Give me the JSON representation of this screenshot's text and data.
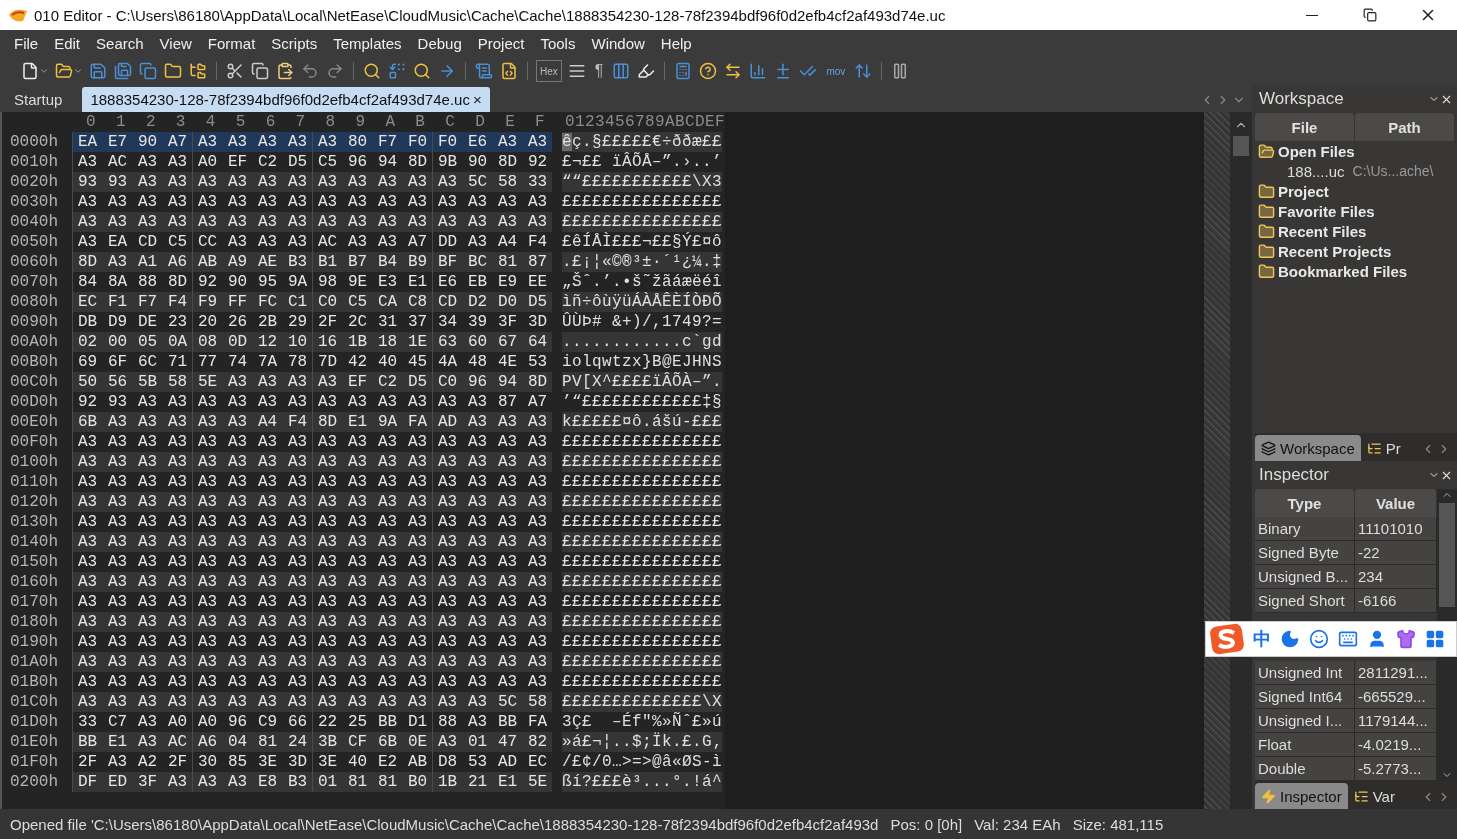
{
  "window": {
    "title": "010 Editor - C:\\Users\\86180\\AppData\\Local\\NetEase\\CloudMusic\\Cache\\Cache\\1888354230-128-78f2394bdf96f0d2efb4cf2af493d74e.uc"
  },
  "menu": [
    "File",
    "Edit",
    "Search",
    "View",
    "Format",
    "Scripts",
    "Templates",
    "Debug",
    "Project",
    "Tools",
    "Window",
    "Help"
  ],
  "toolbar": {
    "hex_label": "Hex",
    "pilcrow": "¶",
    "mov_label": "mov"
  },
  "tabs": [
    {
      "label": "Startup",
      "selected": false
    },
    {
      "label": "1888354230-128-78f2394bdf96f0d2efb4cf2af493d74e.uc",
      "selected": true,
      "close": "×"
    }
  ],
  "hex_view": {
    "columns": [
      "0",
      "1",
      "2",
      "3",
      "4",
      "5",
      "6",
      "7",
      "8",
      "9",
      "A",
      "B",
      "C",
      "D",
      "E",
      "F"
    ],
    "ascii_header": "0123456789ABCDEF",
    "rows": [
      {
        "offset": "0000h",
        "bytes": [
          "EA E7 90 A7",
          "A3 A3 A3 A3",
          "A3 80 F7 F0",
          "F0 E6 A3 A3"
        ],
        "ascii": "êç.§£££££€÷ððæ££",
        "selected": true
      },
      {
        "offset": "0010h",
        "bytes": [
          "A3 AC A3 A3",
          "A0 EF C2 D5",
          "C5 96 94 8D",
          "9B 90 8D 92"
        ],
        "ascii": "£¬££ ïÂÕÅ–”.›..’",
        "selected": false
      },
      {
        "offset": "0020h",
        "bytes": [
          "93 93 A3 A3",
          "A3 A3 A3 A3",
          "A3 A3 A3 A3",
          "A3 5C 58 33"
        ],
        "ascii": "““£££££££££££\\X3",
        "selected": false
      },
      {
        "offset": "0030h",
        "bytes": [
          "A3 A3 A3 A3",
          "A3 A3 A3 A3",
          "A3 A3 A3 A3",
          "A3 A3 A3 A3"
        ],
        "ascii": "££££££££££££££££",
        "selected": false
      },
      {
        "offset": "0040h",
        "bytes": [
          "A3 A3 A3 A3",
          "A3 A3 A3 A3",
          "A3 A3 A3 A3",
          "A3 A3 A3 A3"
        ],
        "ascii": "££££££££££££££££",
        "selected": false
      },
      {
        "offset": "0050h",
        "bytes": [
          "A3 EA CD C5",
          "CC A3 A3 A3",
          "AC A3 A3 A7",
          "DD A3 A4 F4"
        ],
        "ascii": "£êÍÅÌ£££¬££§Ý£¤ô",
        "selected": false
      },
      {
        "offset": "0060h",
        "bytes": [
          "8D A3 A1 A6",
          "AB A9 AE B3",
          "B1 B7 B4 B9",
          "BF BC 81 87"
        ],
        "ascii": ".£¡¦«©®³±·´¹¿¼.‡",
        "selected": false
      },
      {
        "offset": "0070h",
        "bytes": [
          "84 8A 88 8D",
          "92 90 95 9A",
          "98 9E E3 E1",
          "E6 EB E9 EE"
        ],
        "ascii": "„Šˆ.’.•š˜žãáæëéî",
        "selected": false
      },
      {
        "offset": "0080h",
        "bytes": [
          "EC F1 F7 F4",
          "F9 FF FC C1",
          "C0 C5 CA C8",
          "CD D2 D0 D5"
        ],
        "ascii": "ìñ÷ôùÿüÁÀÅÊÈÍÒÐÕ",
        "selected": false
      },
      {
        "offset": "0090h",
        "bytes": [
          "DB D9 DE 23",
          "20 26 2B 29",
          "2F 2C 31 37",
          "34 39 3F 3D"
        ],
        "ascii": "ÛÙÞ# &+)/,1749?=",
        "selected": false
      },
      {
        "offset": "00A0h",
        "bytes": [
          "02 00 05 0A",
          "08 0D 12 10",
          "16 1B 18 1E",
          "63 60 67 64"
        ],
        "ascii": "............c`gd",
        "selected": false
      },
      {
        "offset": "00B0h",
        "bytes": [
          "69 6F 6C 71",
          "77 74 7A 78",
          "7D 42 40 45",
          "4A 48 4E 53"
        ],
        "ascii": "iolqwtzx}B@EJHNS",
        "selected": false
      },
      {
        "offset": "00C0h",
        "bytes": [
          "50 56 5B 58",
          "5E A3 A3 A3",
          "A3 EF C2 D5",
          "C0 96 94 8D"
        ],
        "ascii": "PV[X^££££ïÂÕÀ–”.",
        "selected": false
      },
      {
        "offset": "00D0h",
        "bytes": [
          "92 93 A3 A3",
          "A3 A3 A3 A3",
          "A3 A3 A3 A3",
          "A3 A3 87 A7"
        ],
        "ascii": "’“££££££££££££‡§",
        "selected": false
      },
      {
        "offset": "00E0h",
        "bytes": [
          "6B A3 A3 A3",
          "A3 A3 A4 F4",
          "8D E1 9A FA",
          "AD A3 A3 A3"
        ],
        "ascii": "k£££££¤ô.ášú-£££",
        "selected": false
      },
      {
        "offset": "00F0h",
        "bytes": [
          "A3 A3 A3 A3",
          "A3 A3 A3 A3",
          "A3 A3 A3 A3",
          "A3 A3 A3 A3"
        ],
        "ascii": "££££££££££££££££",
        "selected": false
      },
      {
        "offset": "0100h",
        "bytes": [
          "A3 A3 A3 A3",
          "A3 A3 A3 A3",
          "A3 A3 A3 A3",
          "A3 A3 A3 A3"
        ],
        "ascii": "££££££££££££££££",
        "selected": false
      },
      {
        "offset": "0110h",
        "bytes": [
          "A3 A3 A3 A3",
          "A3 A3 A3 A3",
          "A3 A3 A3 A3",
          "A3 A3 A3 A3"
        ],
        "ascii": "££££££££££££££££",
        "selected": false
      },
      {
        "offset": "0120h",
        "bytes": [
          "A3 A3 A3 A3",
          "A3 A3 A3 A3",
          "A3 A3 A3 A3",
          "A3 A3 A3 A3"
        ],
        "ascii": "££££££££££££££££",
        "selected": false
      },
      {
        "offset": "0130h",
        "bytes": [
          "A3 A3 A3 A3",
          "A3 A3 A3 A3",
          "A3 A3 A3 A3",
          "A3 A3 A3 A3"
        ],
        "ascii": "££££££££££££££££",
        "selected": false
      },
      {
        "offset": "0140h",
        "bytes": [
          "A3 A3 A3 A3",
          "A3 A3 A3 A3",
          "A3 A3 A3 A3",
          "A3 A3 A3 A3"
        ],
        "ascii": "££££££££££££££££",
        "selected": false
      },
      {
        "offset": "0150h",
        "bytes": [
          "A3 A3 A3 A3",
          "A3 A3 A3 A3",
          "A3 A3 A3 A3",
          "A3 A3 A3 A3"
        ],
        "ascii": "££££££££££££££££",
        "selected": false
      },
      {
        "offset": "0160h",
        "bytes": [
          "A3 A3 A3 A3",
          "A3 A3 A3 A3",
          "A3 A3 A3 A3",
          "A3 A3 A3 A3"
        ],
        "ascii": "££££££££££££££££",
        "selected": false
      },
      {
        "offset": "0170h",
        "bytes": [
          "A3 A3 A3 A3",
          "A3 A3 A3 A3",
          "A3 A3 A3 A3",
          "A3 A3 A3 A3"
        ],
        "ascii": "££££££££££££££££",
        "selected": false
      },
      {
        "offset": "0180h",
        "bytes": [
          "A3 A3 A3 A3",
          "A3 A3 A3 A3",
          "A3 A3 A3 A3",
          "A3 A3 A3 A3"
        ],
        "ascii": "££££££££££££££££",
        "selected": false
      },
      {
        "offset": "0190h",
        "bytes": [
          "A3 A3 A3 A3",
          "A3 A3 A3 A3",
          "A3 A3 A3 A3",
          "A3 A3 A3 A3"
        ],
        "ascii": "££££££££££££££££",
        "selected": false
      },
      {
        "offset": "01A0h",
        "bytes": [
          "A3 A3 A3 A3",
          "A3 A3 A3 A3",
          "A3 A3 A3 A3",
          "A3 A3 A3 A3"
        ],
        "ascii": "££££££££££££££££",
        "selected": false
      },
      {
        "offset": "01B0h",
        "bytes": [
          "A3 A3 A3 A3",
          "A3 A3 A3 A3",
          "A3 A3 A3 A3",
          "A3 A3 A3 A3"
        ],
        "ascii": "££££££££££££££££",
        "selected": false
      },
      {
        "offset": "01C0h",
        "bytes": [
          "A3 A3 A3 A3",
          "A3 A3 A3 A3",
          "A3 A3 A3 A3",
          "A3 A3 5C 58"
        ],
        "ascii": "££££££££££££££\\X",
        "selected": false
      },
      {
        "offset": "01D0h",
        "bytes": [
          "33 C7 A3 A0",
          "A0 96 C9 66",
          "22 25 BB D1",
          "88 A3 BB FA"
        ],
        "ascii": "3Ç£  –Éf\"%»Ñˆ£»ú",
        "selected": false
      },
      {
        "offset": "01E0h",
        "bytes": [
          "BB E1 A3 AC",
          "A6 04 81 24",
          "3B CF 6B 0E",
          "A3 01 47 82"
        ],
        "ascii": "»á£¬¦..$;Ïk.£.G‚",
        "selected": false
      },
      {
        "offset": "01F0h",
        "bytes": [
          "2F A3 A2 2F",
          "30 85 3E 3D",
          "3E 40 E2 AB",
          "D8 53 AD EC"
        ],
        "ascii": "/£¢/0…>=>@â«ØS-ì",
        "selected": false
      },
      {
        "offset": "0200h",
        "bytes": [
          "DF ED 3F A3",
          "A3 A3 E8 B3",
          "01 81 81 B0",
          "1B 21 E1 5E"
        ],
        "ascii": "ßí?£££è³...°.!á^",
        "selected": false
      }
    ]
  },
  "workspace": {
    "title": "Workspace",
    "columns": [
      "File",
      "Path"
    ],
    "tree": [
      {
        "label": "Open Files",
        "children": [
          {
            "label": "188....uc",
            "path": "C:\\Us...ache\\"
          }
        ]
      },
      {
        "label": "Project"
      },
      {
        "label": "Favorite Files"
      },
      {
        "label": "Recent Files"
      },
      {
        "label": "Recent Projects"
      },
      {
        "label": "Bookmarked Files"
      }
    ],
    "tabs": [
      {
        "label": "Workspace",
        "selected": true
      },
      {
        "label": "Pr",
        "selected": false
      }
    ]
  },
  "inspector": {
    "title": "Inspector",
    "columns": [
      "Type",
      "Value"
    ],
    "rows": [
      {
        "type": "Binary",
        "value": "11101010"
      },
      {
        "type": "Signed Byte",
        "value": "-22"
      },
      {
        "type": "Unsigned B...",
        "value": "234"
      },
      {
        "type": "Signed Short",
        "value": "-6166"
      },
      {
        "type": "Unsigned Int",
        "value": "2811291..."
      },
      {
        "type": "Signed Int64",
        "value": "-665529..."
      },
      {
        "type": "Unsigned I...",
        "value": "1179144..."
      },
      {
        "type": "Float",
        "value": "-4.0219..."
      },
      {
        "type": "Double",
        "value": "-5.2773..."
      }
    ],
    "tabs": [
      {
        "label": "Inspector",
        "selected": true
      },
      {
        "label": "Var",
        "selected": false
      }
    ]
  },
  "ime_toolbar": {
    "mode": "中"
  },
  "status_bar": {
    "message": "Opened file 'C:\\Users\\86180\\AppData\\Local\\NetEase\\CloudMusic\\Cache\\Cache\\1888354230-128-78f2394bdf96f0d2efb4cf2af493d",
    "position": "Pos: 0 [0h]",
    "value": "Val: 234 EAh",
    "size": "Size: 481,115"
  }
}
